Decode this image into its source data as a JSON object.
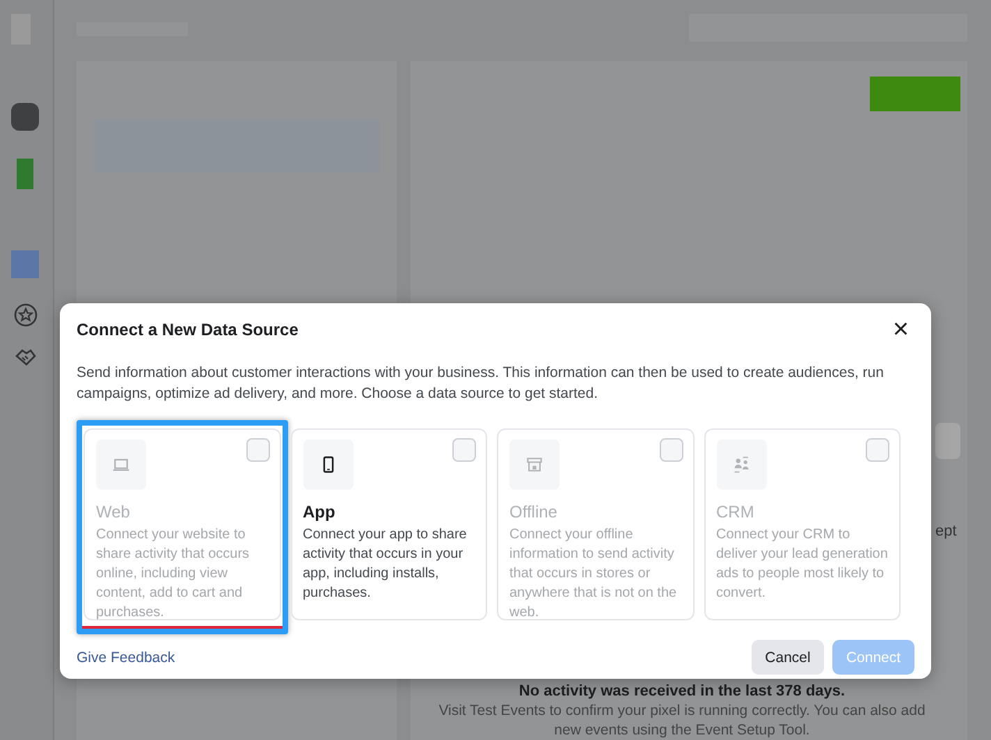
{
  "modal": {
    "title": "Connect a New Data Source",
    "close": "×",
    "description": "Send information about customer interactions with your business. This information can then be used to create audiences, run campaigns, optimize ad delivery, and more. Choose a data source to get started.",
    "sources": [
      {
        "kind": "web",
        "title": "Web",
        "description": "Connect your website to share activity that occurs online, including view content, add to cart and purchases.",
        "disabled": true,
        "highlighted": true,
        "checked": false
      },
      {
        "kind": "app",
        "title": "App",
        "description": "Connect your app to share activity that occurs in your app, including installs, purchases.",
        "disabled": false,
        "highlighted": false,
        "checked": false
      },
      {
        "kind": "offline",
        "title": "Offline",
        "description": "Connect your offline information to send activity that occurs in stores or anywhere that is not on the web.",
        "disabled": true,
        "highlighted": false,
        "checked": false
      },
      {
        "kind": "crm",
        "title": "CRM",
        "description": "Connect your CRM to deliver your lead generation ads to people most likely to convert.",
        "disabled": true,
        "highlighted": false,
        "checked": false
      }
    ],
    "feedback_link": "Give Feedback",
    "buttons": [
      {
        "kind": "secondary",
        "label": "Cancel",
        "disabled": false
      },
      {
        "kind": "primary",
        "label": "Connect",
        "disabled": true
      }
    ]
  },
  "background": {
    "side_text": "ept",
    "empty_title": "No activity was received in the last 378 days.",
    "empty_text": "Visit Test Events to confirm your pixel is running correctly. You can also add new events using the Event Setup Tool."
  }
}
